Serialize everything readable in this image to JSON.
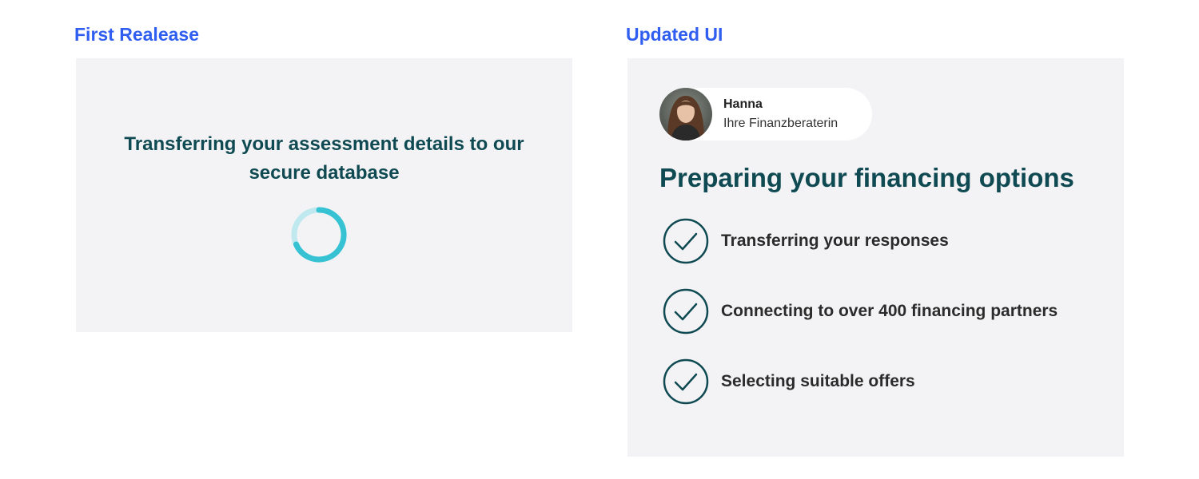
{
  "left": {
    "label": "First Realease",
    "title": "Transferring your assessment details to our secure database"
  },
  "right": {
    "label": "Updated UI",
    "advisor": {
      "name": "Hanna",
      "role": "Ihre Finanzberaterin"
    },
    "title": "Preparing your financing options",
    "steps": [
      {
        "label": "Transferring your responses",
        "icon": "check-circle-icon"
      },
      {
        "label": "Connecting to over 400 financing partners",
        "icon": "check-circle-icon"
      },
      {
        "label": "Selecting suitable offers",
        "icon": "check-circle-icon"
      }
    ]
  },
  "colors": {
    "label_blue": "#2f5ef0",
    "teal_dark": "#0f4a52",
    "spinner_teal": "#36c2d3",
    "panel_bg": "#f3f3f5"
  }
}
